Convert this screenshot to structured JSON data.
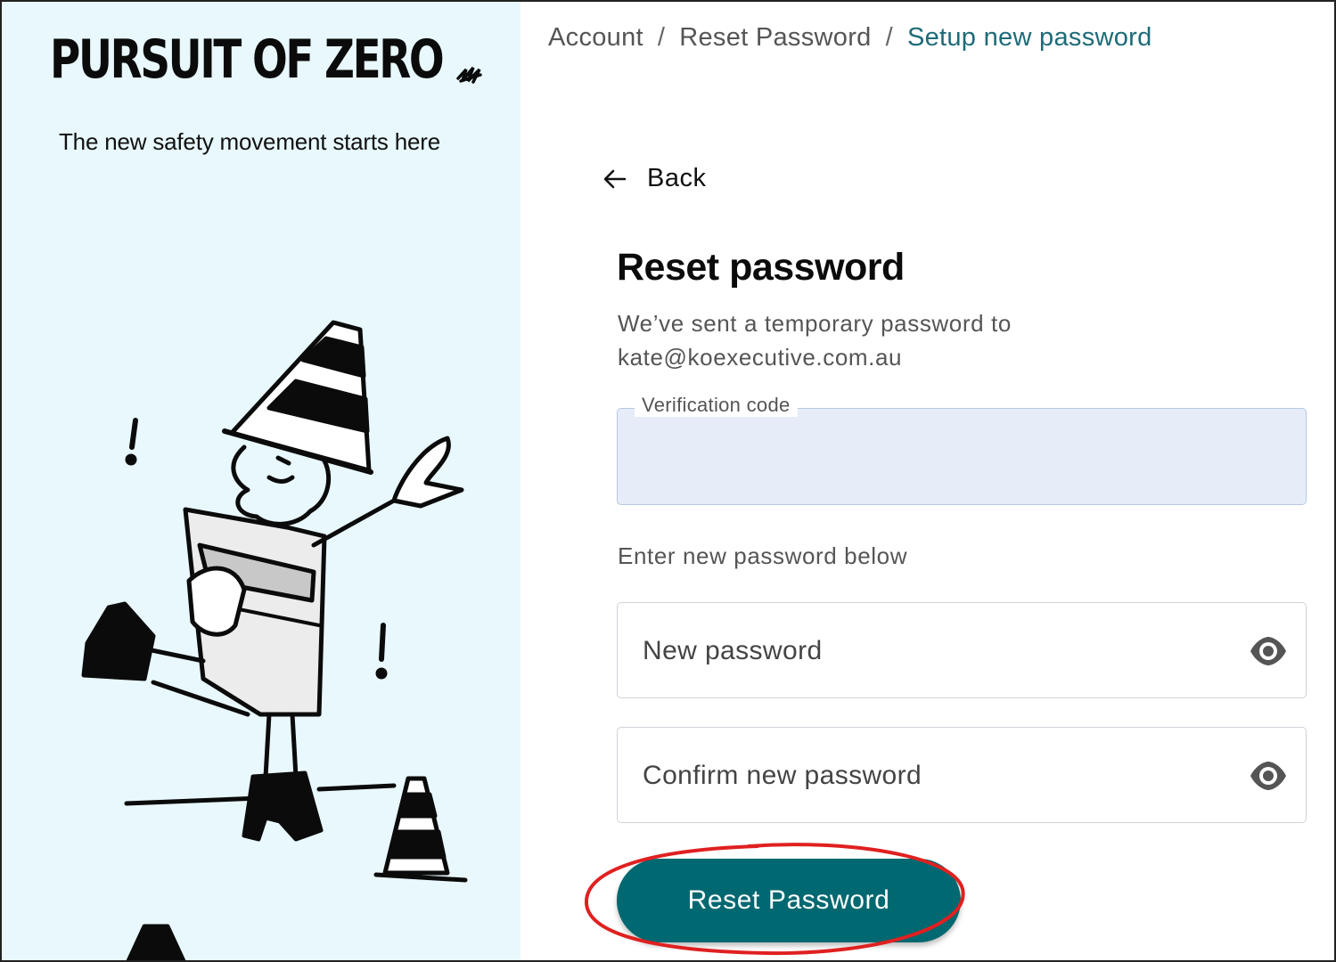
{
  "brand": {
    "logo_text": "PURSUIT OF ZERO",
    "tagline": "The new safety movement starts here"
  },
  "breadcrumb": {
    "items": [
      "Account",
      "Reset Password",
      "Setup new password"
    ],
    "separator": "/"
  },
  "back_link": {
    "label": "Back",
    "icon": "arrow-left-icon"
  },
  "form": {
    "title": "Reset password",
    "subtitle_line1": "We’ve sent a temporary password to",
    "subtitle_line2": "kate@koexecutive.com.au",
    "verification": {
      "label": "Verification code",
      "value": ""
    },
    "helper_text": "Enter new password below",
    "new_password": {
      "placeholder": "New password",
      "icon": "eye-icon"
    },
    "confirm_password": {
      "placeholder": "Confirm new password",
      "icon": "eye-icon"
    },
    "submit_label": "Reset Password"
  },
  "colors": {
    "left_panel_bg": "#e8f8fd",
    "accent": "#006870",
    "breadcrumb_current": "#1d6b78",
    "highlight_circle": "#e02020",
    "verification_bg": "#e6edf9"
  }
}
